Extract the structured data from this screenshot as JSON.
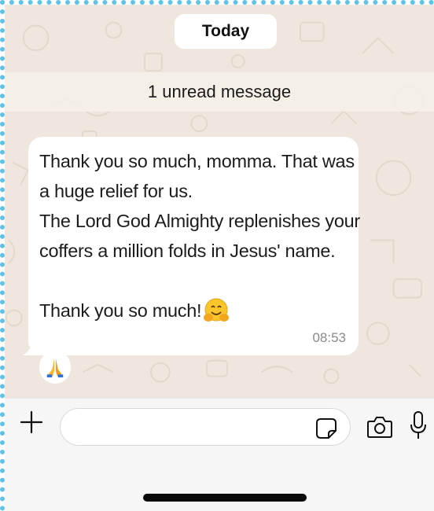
{
  "chat": {
    "date_separator": "Today",
    "unread_banner": "1 unread message",
    "message": {
      "lines": [
        "Thank you so much, momma. That was",
        "a huge relief for us.",
        "The Lord God Almighty replenishes your",
        "coffers a million folds in Jesus' name.",
        "",
        "Thank you so much!"
      ],
      "emoji": "hugging-face",
      "time": "08:53",
      "reaction": "folded-hands"
    }
  },
  "input_bar": {
    "placeholder": "",
    "icons": [
      "plus-icon",
      "sticker-icon",
      "camera-icon",
      "microphone-icon"
    ]
  },
  "colors": {
    "chat_background": "#efe7de",
    "bubble": "#ffffff",
    "input_bar": "#f6f6f6",
    "timestamp": "#8a8a8a"
  }
}
